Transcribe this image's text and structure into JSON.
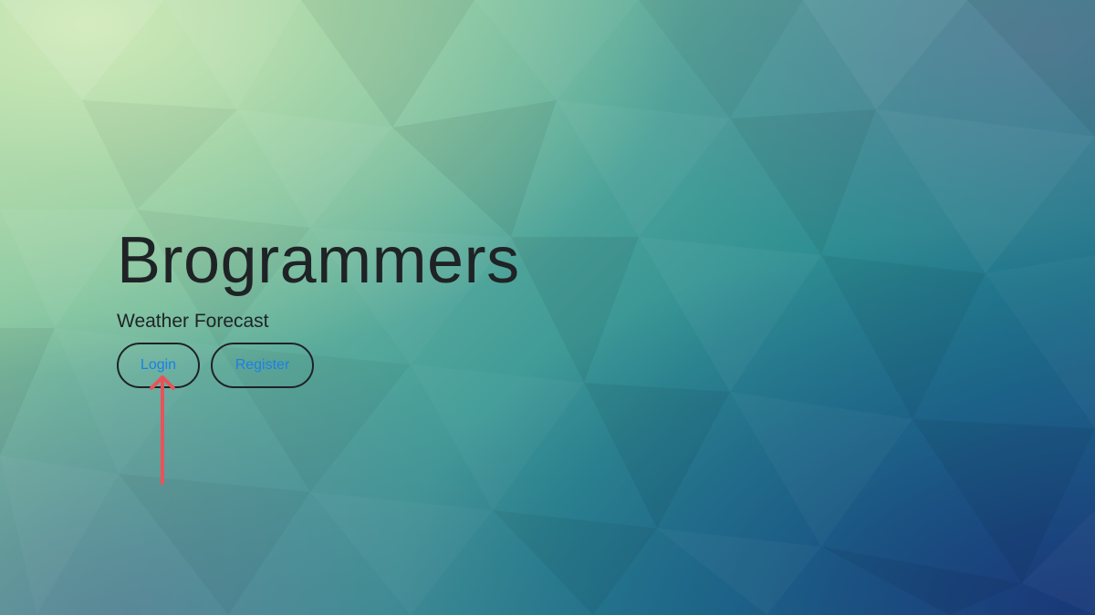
{
  "hero": {
    "title": "Brogrammers",
    "subtitle": "Weather Forecast"
  },
  "actions": {
    "login_label": "Login",
    "register_label": "Register"
  },
  "annotation": {
    "icon": "arrow-up-icon",
    "color": "#e8535a"
  },
  "colors": {
    "button_text": "#1c7fe6",
    "heading_text": "#1f2326",
    "background_light": "#b7dcae",
    "background_dark": "#1d4e86"
  }
}
